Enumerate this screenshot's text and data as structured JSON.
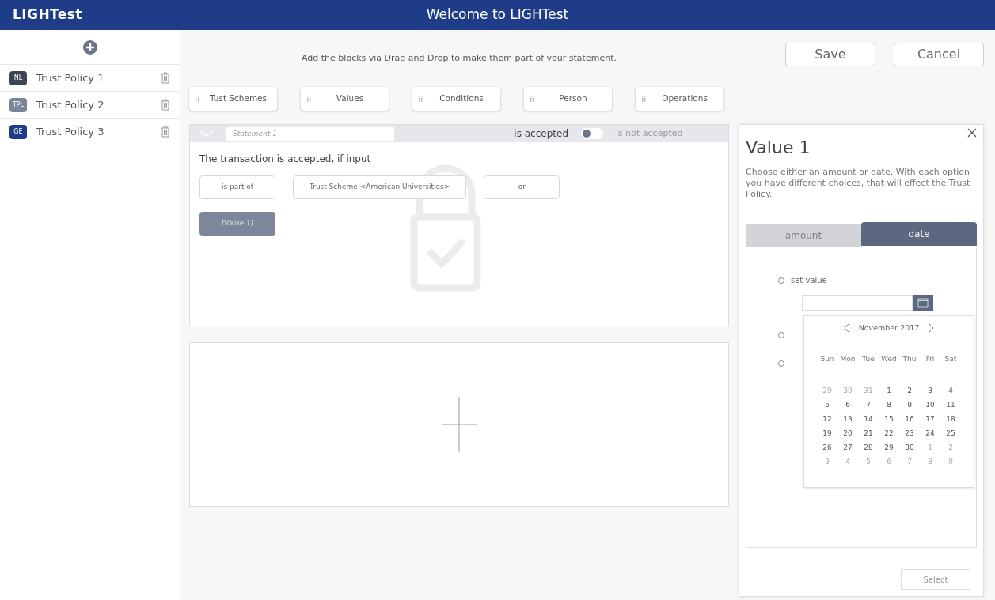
{
  "header": {
    "logo": "LIGHTest",
    "title": "Welcome to LIGHTest"
  },
  "sidebar": {
    "policies": [
      {
        "badge": "NL",
        "color": "#3d4453",
        "label": "Trust Policy 1"
      },
      {
        "badge": "TPL",
        "color": "#7c8597",
        "label": "Trust Policy 2"
      },
      {
        "badge": "GE",
        "color": "#1f3c88",
        "label": "Trust Policy 3"
      }
    ]
  },
  "instruction": "Add the blocks via Drag and Drop to make them part of your statement.",
  "actions": [
    "Save",
    "Cancel"
  ],
  "blocks": [
    "Tust Schemes",
    "Values",
    "Conditions",
    "Person",
    "Operations"
  ],
  "statement": {
    "placeholder": "Statement 1",
    "accepted_label": "is accepted",
    "not_accepted_label": "is not accepted",
    "toggle_on": false,
    "sentence": "The transaction is accepted, if input",
    "chips": [
      {
        "kind": "plain",
        "text": "is part of"
      },
      {
        "kind": "plain",
        "text": "Trust Scheme <American Universities>"
      },
      {
        "kind": "plain",
        "text": "or"
      },
      {
        "kind": "value",
        "text": "[Value 1]"
      }
    ]
  },
  "panel": {
    "title": "Value 1",
    "description": "Choose either an amount or date. With each option you have different choices, that will effect the Trust Policy.",
    "tabs": [
      {
        "label": "amount",
        "selected": false
      },
      {
        "label": "date",
        "selected": true
      }
    ],
    "options": [
      {
        "label": "set value",
        "selected": false
      },
      {
        "selected": false
      },
      {
        "selected": false
      }
    ],
    "button": "Select"
  },
  "calendar": {
    "month": "November 2017",
    "weekdays": [
      "Sun",
      "Mon",
      "Tue",
      "Wed",
      "Thu",
      "Fri",
      "Sat"
    ],
    "weeks": [
      [
        {
          "d": "29",
          "outside": true
        },
        {
          "d": "30",
          "outside": true
        },
        {
          "d": "31",
          "outside": true
        },
        {
          "d": "1",
          "outside": false
        },
        {
          "d": "2",
          "outside": false
        },
        {
          "d": "3",
          "outside": false
        },
        {
          "d": "4",
          "outside": false
        }
      ],
      [
        {
          "d": "5",
          "outside": false
        },
        {
          "d": "6",
          "outside": false
        },
        {
          "d": "7",
          "outside": false
        },
        {
          "d": "8",
          "outside": false
        },
        {
          "d": "9",
          "outside": false
        },
        {
          "d": "10",
          "outside": false
        },
        {
          "d": "11",
          "outside": false
        }
      ],
      [
        {
          "d": "12",
          "outside": false
        },
        {
          "d": "13",
          "outside": false
        },
        {
          "d": "14",
          "outside": false
        },
        {
          "d": "15",
          "outside": false
        },
        {
          "d": "16",
          "outside": false
        },
        {
          "d": "17",
          "outside": false
        },
        {
          "d": "18",
          "outside": false
        }
      ],
      [
        {
          "d": "19",
          "outside": false
        },
        {
          "d": "20",
          "outside": false
        },
        {
          "d": "21",
          "outside": false
        },
        {
          "d": "22",
          "outside": false
        },
        {
          "d": "23",
          "outside": false
        },
        {
          "d": "24",
          "outside": false
        },
        {
          "d": "25",
          "outside": false
        }
      ],
      [
        {
          "d": "26",
          "outside": false
        },
        {
          "d": "27",
          "outside": false
        },
        {
          "d": "28",
          "outside": false
        },
        {
          "d": "29",
          "outside": false
        },
        {
          "d": "30",
          "outside": false
        },
        {
          "d": "1",
          "outside": true
        },
        {
          "d": "2",
          "outside": true
        }
      ],
      [
        {
          "d": "3",
          "outside": true
        },
        {
          "d": "4",
          "outside": true
        },
        {
          "d": "5",
          "outside": true
        },
        {
          "d": "6",
          "outside": true
        },
        {
          "d": "7",
          "outside": true
        },
        {
          "d": "8",
          "outside": true
        },
        {
          "d": "9",
          "outside": true
        }
      ]
    ]
  }
}
